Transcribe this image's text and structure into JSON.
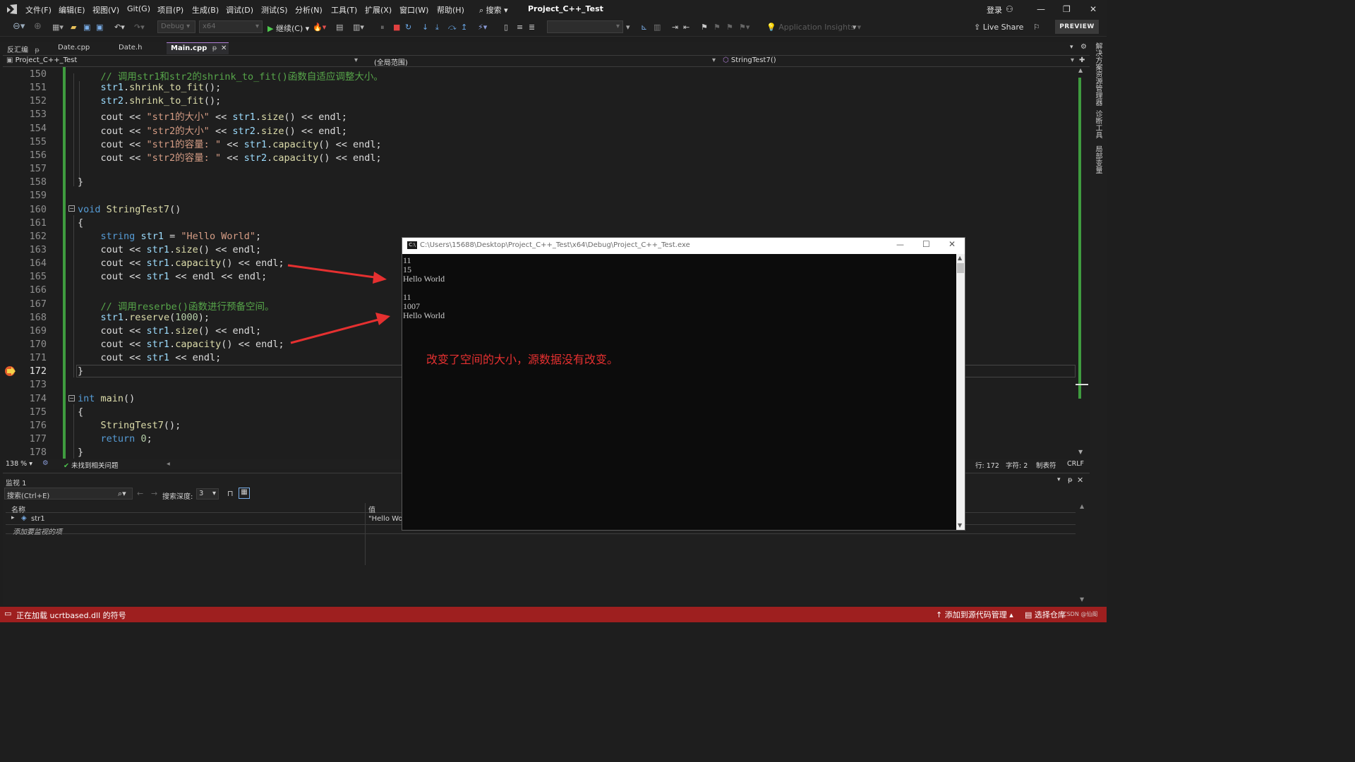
{
  "menubar": {
    "items": [
      "文件(F)",
      "编辑(E)",
      "视图(V)",
      "Git(G)",
      "项目(P)",
      "生成(B)",
      "调试(D)",
      "测试(S)",
      "分析(N)",
      "工具(T)",
      "扩展(X)",
      "窗口(W)",
      "帮助(H)"
    ],
    "search_label": "搜索",
    "title": "Project_C++_Test",
    "login": "登录"
  },
  "toolbar": {
    "config": "Debug",
    "platform": "x64",
    "continue_label": "继续(C)",
    "app_insights": "Application Insights",
    "live_share": "Live Share",
    "preview": "PREVIEW"
  },
  "tabs": [
    {
      "label": "反汇编",
      "pin": "ᵽ"
    },
    {
      "label": "Date.cpp"
    },
    {
      "label": "Date.h"
    },
    {
      "label": "Main.cpp",
      "active": true
    }
  ],
  "navbar": {
    "project": "Project_C++_Test",
    "scope": "(全局范围)",
    "function": "StringTest7()"
  },
  "right_strip": [
    "解决方案资源管理器",
    "诊断工具",
    "局部变量"
  ],
  "editor": {
    "current_line": 172,
    "lines": [
      {
        "n": 150,
        "code": "    // 调用str1和str2的shrink_to_fit()函数自适应调整大小。"
      },
      {
        "n": 151,
        "code": "    str1.shrink_to_fit();"
      },
      {
        "n": 152,
        "code": "    str2.shrink_to_fit();"
      },
      {
        "n": 153,
        "code": "    cout << \"str1的大小\" << str1.size() << endl;"
      },
      {
        "n": 154,
        "code": "    cout << \"str2的大小\" << str2.size() << endl;"
      },
      {
        "n": 155,
        "code": "    cout << \"str1的容量: \" << str1.capacity() << endl;"
      },
      {
        "n": 156,
        "code": "    cout << \"str2的容量: \" << str2.capacity() << endl;"
      },
      {
        "n": 157,
        "code": ""
      },
      {
        "n": 158,
        "code": "}"
      },
      {
        "n": 159,
        "code": ""
      },
      {
        "n": 160,
        "code": "void StringTest7()"
      },
      {
        "n": 161,
        "code": "{"
      },
      {
        "n": 162,
        "code": "    string str1 = \"Hello World\";"
      },
      {
        "n": 163,
        "code": "    cout << str1.size() << endl;"
      },
      {
        "n": 164,
        "code": "    cout << str1.capacity() << endl;"
      },
      {
        "n": 165,
        "code": "    cout << str1 << endl << endl;"
      },
      {
        "n": 166,
        "code": ""
      },
      {
        "n": 167,
        "code": "    // 调用reserbe()函数进行预备空间。"
      },
      {
        "n": 168,
        "code": "    str1.reserve(1000);"
      },
      {
        "n": 169,
        "code": "    cout << str1.size() << endl;"
      },
      {
        "n": 170,
        "code": "    cout << str1.capacity() << endl;"
      },
      {
        "n": 171,
        "code": "    cout << str1 << endl;"
      },
      {
        "n": 172,
        "code": "}"
      },
      {
        "n": 173,
        "code": ""
      },
      {
        "n": 174,
        "code": "int main()"
      },
      {
        "n": 175,
        "code": "{"
      },
      {
        "n": 176,
        "code": "    StringTest7();"
      },
      {
        "n": 177,
        "code": "    return 0;"
      },
      {
        "n": 178,
        "code": "}"
      }
    ]
  },
  "editor_status": {
    "zoom": "138 %",
    "issues": "未找到相关问题",
    "row": "行: 172",
    "col": "字符: 2",
    "tabs": "制表符",
    "eol": "CRLF"
  },
  "watch": {
    "title": "监视 1",
    "search_placeholder": "搜索(Ctrl+E)",
    "depth_label": "搜索深度:",
    "depth_value": "3",
    "col_name": "名称",
    "col_value": "值",
    "rows": [
      {
        "name": "str1",
        "value": "\"Hello Worl"
      }
    ],
    "add_item": "添加要监视的项"
  },
  "console": {
    "title": "C:\\Users\\15688\\Desktop\\Project_C++_Test\\x64\\Debug\\Project_C++_Test.exe",
    "lines": [
      "11",
      "15",
      "Hello World",
      "",
      "11",
      "1007",
      "Hello World"
    ]
  },
  "annotation": "改变了空间的大小，源数据没有改变。",
  "statusbar": {
    "message": "正在加载 ucrtbased.dll 的符号",
    "source_control": "添加到源代码管理",
    "repo": "选择仓库",
    "watermark": "CSDN @仙阁"
  },
  "colors": {
    "accent": "#b180d7",
    "status_bg": "#9e1f1f",
    "arrow": "#e53030",
    "gutter_green": "#3f9b3f"
  }
}
